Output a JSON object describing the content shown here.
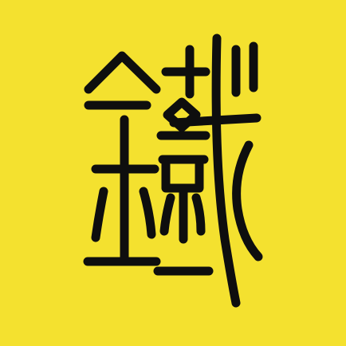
{
  "app_icon": {
    "glyph_label": "鐵",
    "glyph_style": "seal-script",
    "icon_name": "seal-character-tie-icon",
    "colors": {
      "background": "#F4E12F",
      "stroke": "#0E0E0E"
    }
  }
}
